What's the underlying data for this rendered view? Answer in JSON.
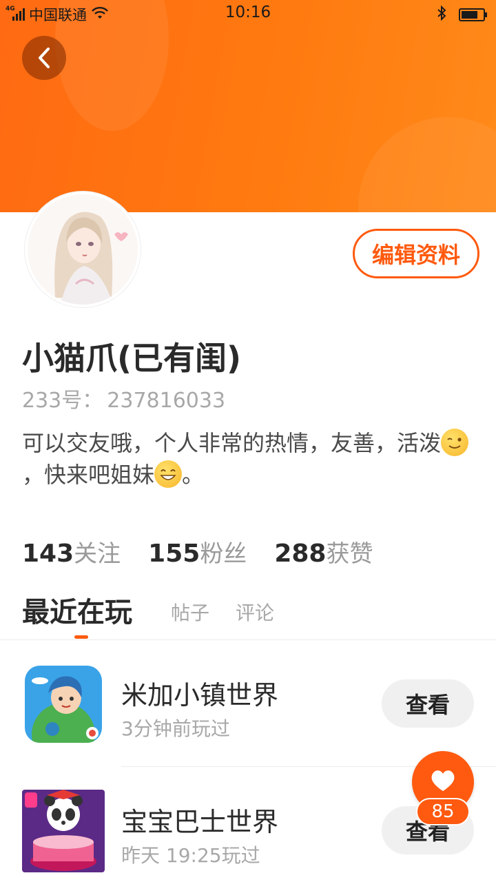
{
  "status_bar": {
    "network": "4G",
    "carrier": "中国联通",
    "time": "10:16",
    "battery_level": 0.75
  },
  "header": {
    "back_icon": "chevron-left-icon",
    "colors": {
      "gradient_start": "#ff6a12",
      "gradient_end": "#ff8a1a",
      "accent": "#ff5a0f"
    }
  },
  "profile": {
    "edit_button": "编辑资料",
    "username": "小猫爪(已有闺)",
    "id_label": "233号：",
    "id_value": "237816033",
    "bio_part1": "可以交友哦，个人非常的热情，友善，活泼",
    "bio_part2": "，快来吧姐妹",
    "bio_part3": "。",
    "emoji1": "winking-face-icon",
    "emoji2": "grinning-face-icon"
  },
  "stats": [
    {
      "count": "143",
      "label": "关注"
    },
    {
      "count": "155",
      "label": "粉丝"
    },
    {
      "count": "288",
      "label": "获赞"
    }
  ],
  "tabs": [
    {
      "label": "最近在玩",
      "active": true
    },
    {
      "label": "帖子",
      "active": false
    },
    {
      "label": "评论",
      "active": false
    }
  ],
  "games": [
    {
      "title": "米加小镇世界",
      "last_played": "3分钟前玩过",
      "button": "查看"
    },
    {
      "title": "宝宝巴士世界",
      "last_played": "昨天 19:25玩过",
      "button": "查看"
    }
  ],
  "like_fab": {
    "count": "85"
  }
}
